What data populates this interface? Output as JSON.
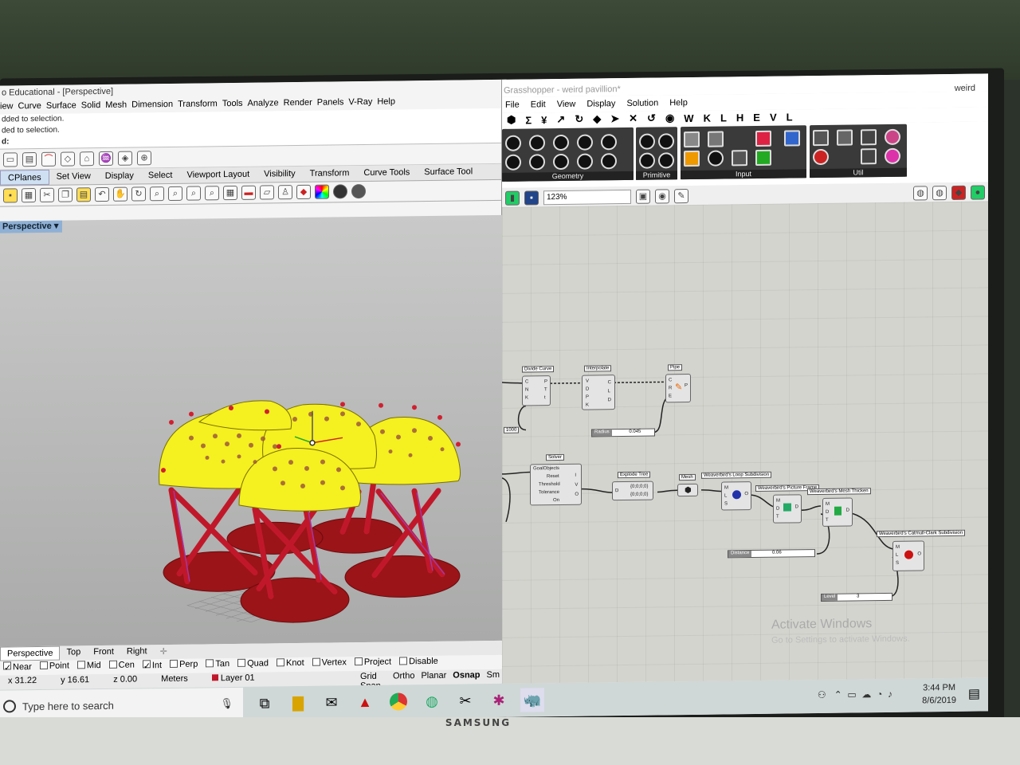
{
  "rhino": {
    "title": "o Educational - [Perspective]",
    "menu": [
      "iew",
      "Curve",
      "Surface",
      "Solid",
      "Mesh",
      "Dimension",
      "Transform",
      "Tools",
      "Analyze",
      "Render",
      "Panels",
      "V-Ray",
      "Help"
    ],
    "command_history": [
      "dded to selection.",
      "ded to selection."
    ],
    "command_prompt": "d:",
    "tabs": [
      "CPlanes",
      "Set View",
      "Display",
      "Select",
      "Viewport Layout",
      "Visibility",
      "Transform",
      "Curve Tools",
      "Surface Tool"
    ],
    "viewport_label": "Perspective",
    "axes": {
      "x": "x",
      "y": "y",
      "z": "z"
    },
    "viewport_tabs": [
      "Perspective",
      "Top",
      "Front",
      "Right"
    ],
    "osnaps": [
      {
        "label": "Near",
        "checked": true
      },
      {
        "label": "Point",
        "checked": false
      },
      {
        "label": "Mid",
        "checked": false
      },
      {
        "label": "Cen",
        "checked": false
      },
      {
        "label": "Int",
        "checked": true
      },
      {
        "label": "Perp",
        "checked": false
      },
      {
        "label": "Tan",
        "checked": false
      },
      {
        "label": "Quad",
        "checked": false
      },
      {
        "label": "Knot",
        "checked": false
      },
      {
        "label": "Vertex",
        "checked": false
      },
      {
        "label": "Project",
        "checked": false
      },
      {
        "label": "Disable",
        "checked": false
      }
    ],
    "status": {
      "x": "x 31.22",
      "y": "y 16.61",
      "z": "z 0.00",
      "units": "Meters",
      "layer": "Layer 01"
    },
    "status_modes": [
      "Grid Snap",
      "Ortho",
      "Planar",
      "Osnap",
      "Sm"
    ]
  },
  "grasshopper": {
    "title": "Grasshopper - weird pavillion*",
    "doc": "weird",
    "menu": [
      "File",
      "Edit",
      "View",
      "Display",
      "Solution",
      "Help"
    ],
    "tabs": [
      "W",
      "K",
      "L",
      "H",
      "E",
      "V",
      "L"
    ],
    "groups": [
      "Geometry",
      "Primitive",
      "Input",
      "Util"
    ],
    "zoom": "123%",
    "components": {
      "divide_curve": {
        "label": "Divide Curve",
        "inputs": "C\nN\nK",
        "outputs": "P\nT\nt"
      },
      "interpolate": {
        "label": "Interpolate",
        "inputs": "V\nD\nP\nK",
        "outputs": "C\nL\nD"
      },
      "pipe": {
        "label": "Pipe",
        "inputs": "C\nR\nE",
        "outputs": "P"
      },
      "solver": {
        "label": "Solver",
        "inputs": [
          "GoalObjects",
          "Reset",
          "Threshold",
          "Tolerance",
          "On"
        ],
        "outputs": "I\nV\nO"
      },
      "explode_tree": {
        "label": "Explode Tree",
        "input": "D",
        "outputs": [
          "{0;0;0;0}",
          "{0;0;0;0}"
        ]
      },
      "mesh": {
        "label": "Mesh"
      },
      "loop": {
        "label": "Weaverbird's Loop Subdivision",
        "inputs": "M\nL\nS",
        "outputs": "O"
      },
      "picture_frame": {
        "label": "Weaverbird's Picture Frame",
        "inputs": "M\nD\nT",
        "outputs": "D"
      },
      "thicken": {
        "label": "Weaverbird's Mesh Thicken",
        "inputs": "M\nD\nT",
        "outputs": "D"
      },
      "catmull": {
        "label": "Weaverbird's Catmull-Clark Subdivision",
        "inputs": "M\nL\nS",
        "outputs": "O"
      }
    },
    "panel_value": "1000",
    "sliders": {
      "radius": {
        "label": "Radius",
        "value": "0.045"
      },
      "distance": {
        "label": "Distance",
        "value": "0.06"
      },
      "level": {
        "label": "Level",
        "value": "3"
      }
    },
    "watermark": {
      "title": "Activate Windows",
      "subtitle": "Go to Settings to activate Windows."
    }
  },
  "taskbar": {
    "search_placeholder": "Type here to search",
    "time": "3:44 PM",
    "date": "8/6/2019"
  },
  "monitor_brand": "SAMSUNG",
  "colors": {
    "dome": "#f5f020",
    "frame": "#c0182a",
    "base": "#9a1418",
    "viewport_bg": "#b8b9b8"
  }
}
